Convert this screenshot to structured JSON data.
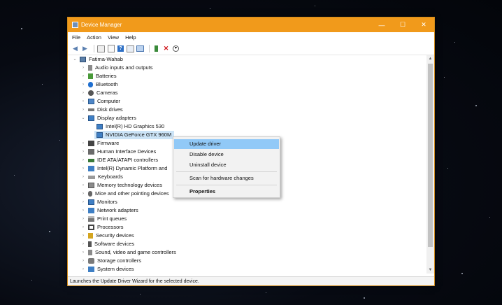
{
  "window": {
    "title": "Device Manager",
    "controls": [
      "—",
      "☐",
      "✕"
    ]
  },
  "menu": [
    "File",
    "Action",
    "View",
    "Help"
  ],
  "tree": {
    "root": "Fatima-Wahab",
    "items": [
      {
        "label": "Audio inputs and outputs",
        "icon": "speaker-icon"
      },
      {
        "label": "Batteries",
        "icon": "battery-icon"
      },
      {
        "label": "Bluetooth",
        "icon": "bluetooth-icon"
      },
      {
        "label": "Cameras",
        "icon": "camera-icon"
      },
      {
        "label": "Computer",
        "icon": "computer-icon"
      },
      {
        "label": "Disk drives",
        "icon": "disk-icon"
      },
      {
        "label": "Display adapters",
        "icon": "display-icon"
      },
      {
        "label": "Intel(R) HD Graphics 530",
        "icon": "display-icon"
      },
      {
        "label": "NVIDIA GeForce GTX 960M",
        "icon": "display-icon"
      },
      {
        "label": "Firmware",
        "icon": "firmware-icon"
      },
      {
        "label": "Human Interface Devices",
        "icon": "hid-icon"
      },
      {
        "label": "IDE ATA/ATAPI controllers",
        "icon": "ide-icon"
      },
      {
        "label": "Intel(R) Dynamic Platform and",
        "icon": "platform-icon"
      },
      {
        "label": "Keyboards",
        "icon": "keyboard-icon"
      },
      {
        "label": "Memory technology devices",
        "icon": "memory-icon"
      },
      {
        "label": "Mice and other pointing devices",
        "icon": "mouse-icon"
      },
      {
        "label": "Monitors",
        "icon": "monitor-icon"
      },
      {
        "label": "Network adapters",
        "icon": "network-icon"
      },
      {
        "label": "Print queues",
        "icon": "printer-icon"
      },
      {
        "label": "Processors",
        "icon": "processor-icon"
      },
      {
        "label": "Security devices",
        "icon": "security-icon"
      },
      {
        "label": "Software devices",
        "icon": "software-icon"
      },
      {
        "label": "Sound, video and game controllers",
        "icon": "sound-icon"
      },
      {
        "label": "Storage controllers",
        "icon": "storage-icon"
      },
      {
        "label": "System devices",
        "icon": "system-icon"
      }
    ]
  },
  "context_menu": {
    "update_driver": "Update driver",
    "disable_device": "Disable device",
    "uninstall_device": "Uninstall device",
    "scan": "Scan for hardware changes",
    "properties": "Properties"
  },
  "status": "Launches the Update Driver Wizard for the selected device.",
  "colors": {
    "titlebar": "#f19a1b",
    "selection": "#cce4f7",
    "menu_highlight": "#91c9f7"
  }
}
